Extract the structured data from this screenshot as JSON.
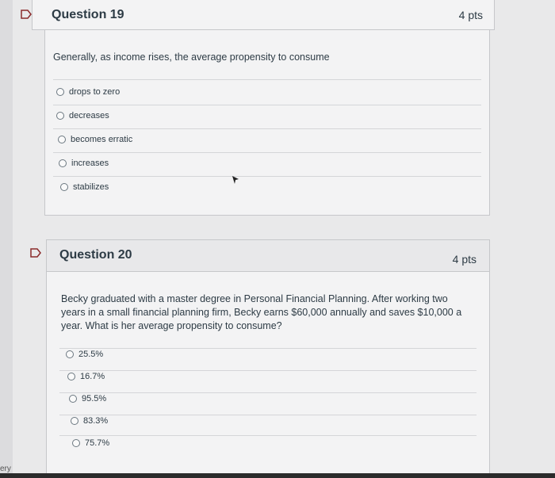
{
  "questions": [
    {
      "title": "Question 19",
      "points": "4 pts",
      "text": "Generally, as income rises, the average propensity to consume",
      "answers": [
        "drops to zero",
        "decreases",
        "becomes erratic",
        "increases",
        "stabilizes"
      ]
    },
    {
      "title": "Question 20",
      "points": "4 pts",
      "text": "Becky graduated with a master degree in Personal Financial Planning. After working two years in a small financial planning firm, Becky earns $60,000 annually and saves $10,000 a year. What is her average propensity to consume?",
      "answers": [
        "25.5%",
        "16.7%",
        "95.5%",
        "83.3%",
        "75.7%"
      ]
    }
  ],
  "footer": {
    "edge_text": "ery"
  },
  "icons": {
    "flag": "flag-icon",
    "cursor": "mouse-cursor-icon",
    "radio": "radio-button"
  },
  "colors": {
    "flag": "#8a2a2a",
    "card": "#f3f3f4",
    "header": "#e8e8ea",
    "text": "#2d3b45"
  }
}
